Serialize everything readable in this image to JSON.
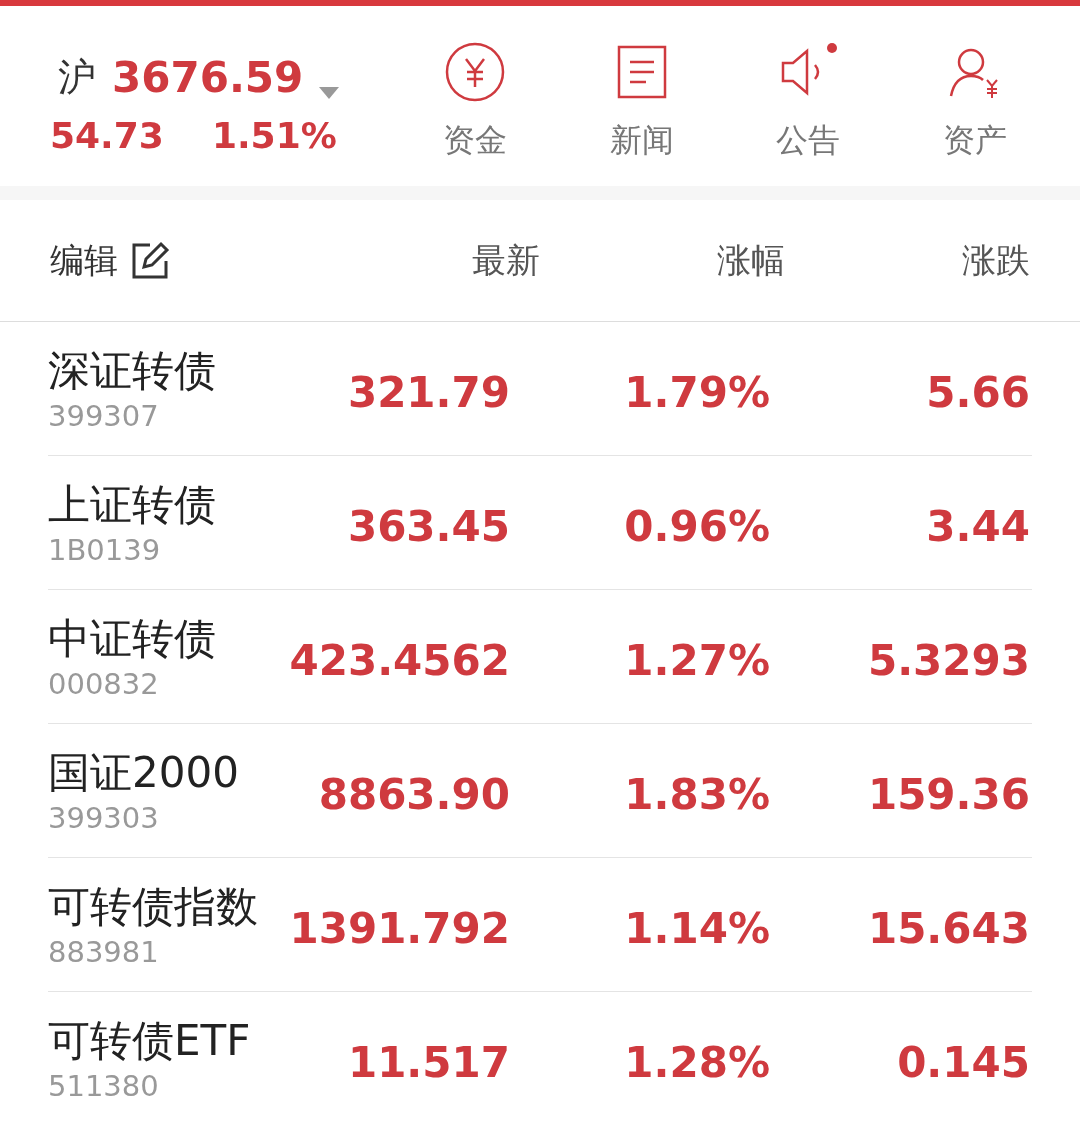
{
  "index": {
    "market": "沪",
    "price": "3676.59",
    "change": "54.73",
    "percent": "1.51%"
  },
  "shortcuts": [
    {
      "kind": "yuan",
      "label": "资金"
    },
    {
      "kind": "news",
      "label": "新闻"
    },
    {
      "kind": "speaker",
      "label": "公告"
    },
    {
      "kind": "user",
      "label": "资产"
    }
  ],
  "table": {
    "edit": "编辑",
    "columns": [
      "最新",
      "涨幅",
      "涨跌"
    ],
    "rows": [
      {
        "name": "深证转债",
        "code": "399307",
        "values": [
          "321.79",
          "1.79%",
          "5.66"
        ]
      },
      {
        "name": "上证转债",
        "code": "1B0139",
        "values": [
          "363.45",
          "0.96%",
          "3.44"
        ]
      },
      {
        "name": "中证转债",
        "code": "000832",
        "values": [
          "423.4562",
          "1.27%",
          "5.3293"
        ]
      },
      {
        "name": "国证2000",
        "code": "399303",
        "values": [
          "8863.90",
          "1.83%",
          "159.36"
        ]
      },
      {
        "name": "可转债指数",
        "code": "883981",
        "values": [
          "1391.792",
          "1.14%",
          "15.643"
        ]
      },
      {
        "name": "可转债ETF",
        "code": "511380",
        "values": [
          "11.517",
          "1.28%",
          "0.145"
        ]
      }
    ]
  }
}
